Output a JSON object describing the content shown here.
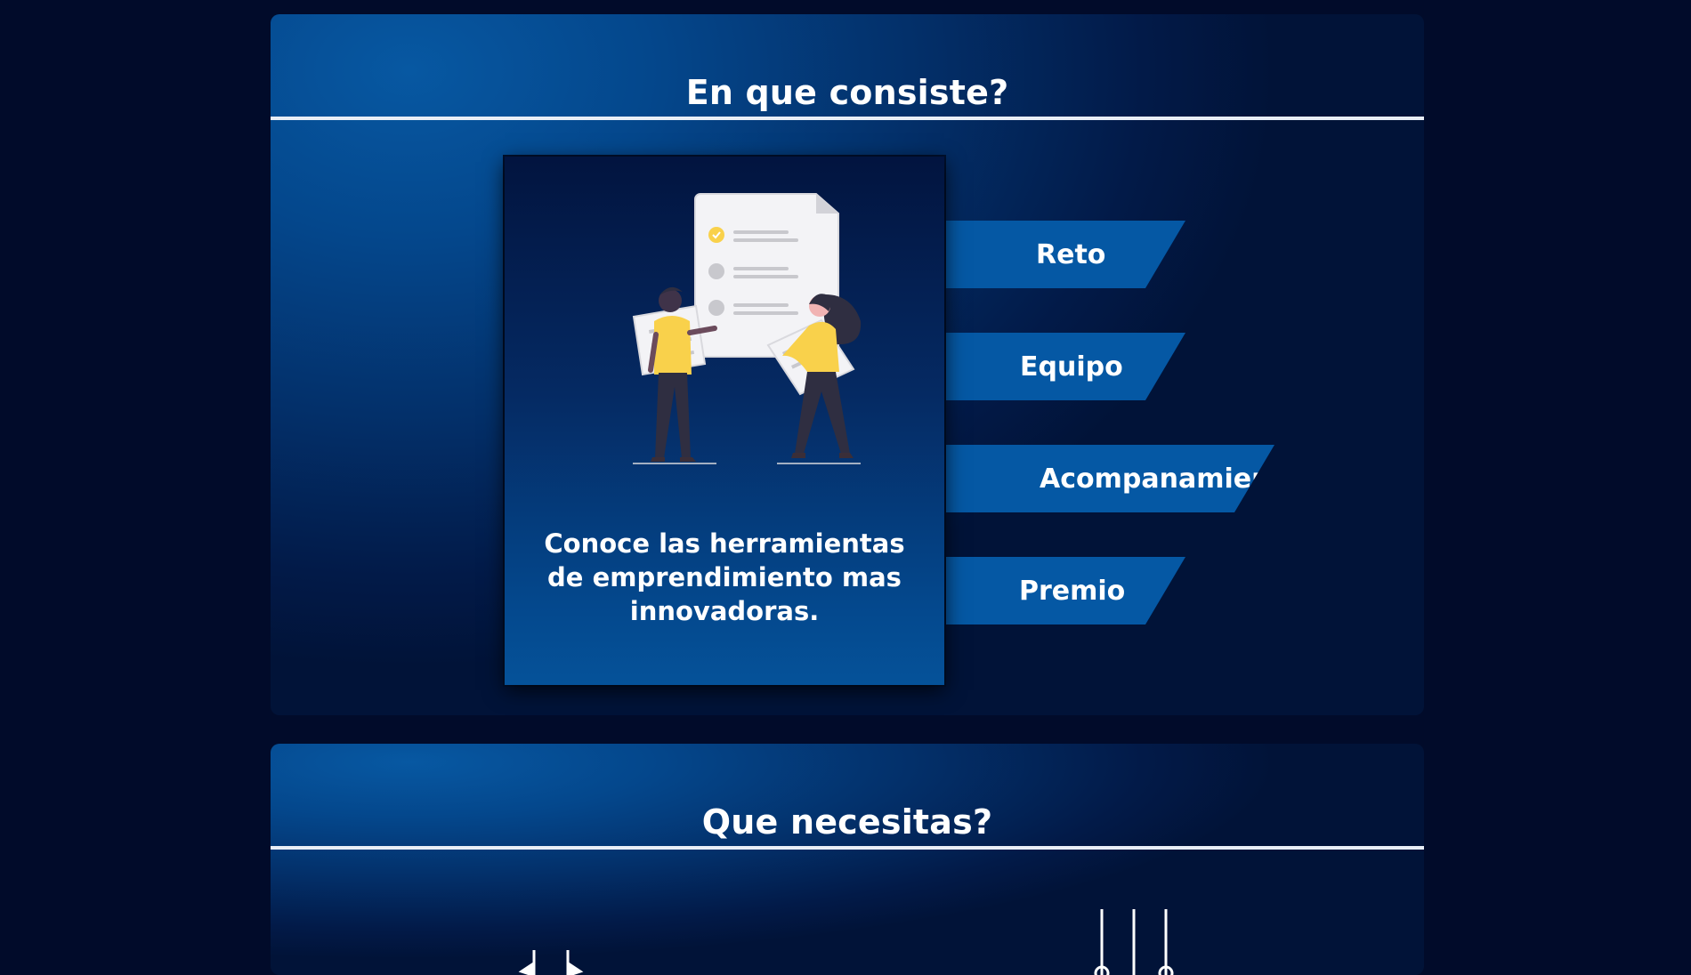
{
  "sections": {
    "consiste": {
      "title": "En que consiste?",
      "card_text": "Conoce las herramientas de emprendimiento mas innovadoras.",
      "tabs": [
        {
          "label": "Reto"
        },
        {
          "label": "Equipo"
        },
        {
          "label": "Acompanamiento"
        },
        {
          "label": "Premio"
        }
      ]
    },
    "necesitas": {
      "title": "Que necesitas?"
    }
  },
  "colors": {
    "page_background": "#010b2a",
    "panel_gradient_light": "#0758a2",
    "panel_gradient_dark": "#011338",
    "tab_fill": "#0558a4",
    "accent_yellow": "#f9d14b",
    "divider": "#e9eef6"
  },
  "icons": {
    "illustration": "people-holding-checklist-illustration",
    "bottom_left": "scale-icon",
    "bottom_right": "sliders-icon"
  }
}
